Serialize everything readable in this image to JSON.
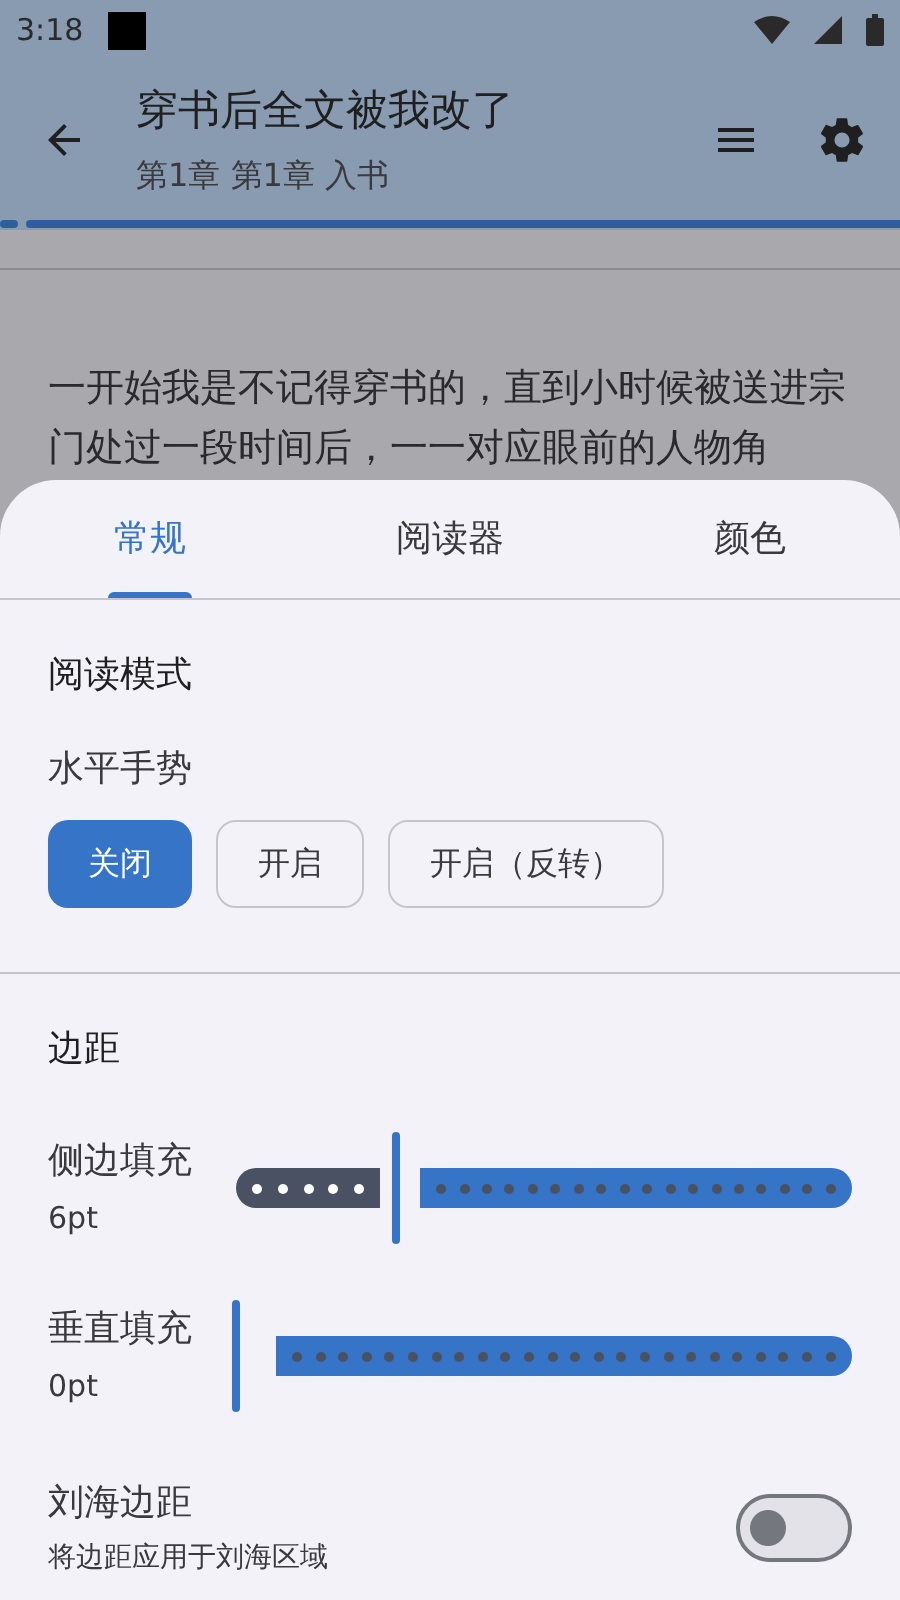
{
  "status_bar": {
    "time": "3:18"
  },
  "toolbar": {
    "title": "穿书后全文被我改了",
    "subtitle": "第1章 第1章 入书"
  },
  "reading_progress": {
    "level": 0.01
  },
  "content": {
    "paragraph": "一开始我是不记得穿书的，直到小时候被送进宗门处过一段时间后，一一对应眼前的人物角"
  },
  "tabs": [
    {
      "label": "常规",
      "selected": true
    },
    {
      "label": "阅读器",
      "selected": false
    },
    {
      "label": "颜色",
      "selected": false
    }
  ],
  "sections": [
    {
      "title": "阅读模式",
      "items": [
        {
          "kind": "choice",
          "label": "水平手势",
          "options": [
            {
              "label": "关闭",
              "selected": true
            },
            {
              "label": "开启",
              "selected": false
            },
            {
              "label": "开启（反转）",
              "selected": false
            }
          ]
        }
      ]
    },
    {
      "title": "边距",
      "items": [
        {
          "kind": "slider",
          "label": "侧边填充",
          "reading": "6pt",
          "level": 0.26
        },
        {
          "kind": "slider",
          "label": "垂直填充",
          "reading": "0pt",
          "level": 0
        },
        {
          "kind": "switch",
          "label": "刘海边距",
          "description": "将边距应用于刘海区域",
          "on": false
        }
      ]
    }
  ]
}
